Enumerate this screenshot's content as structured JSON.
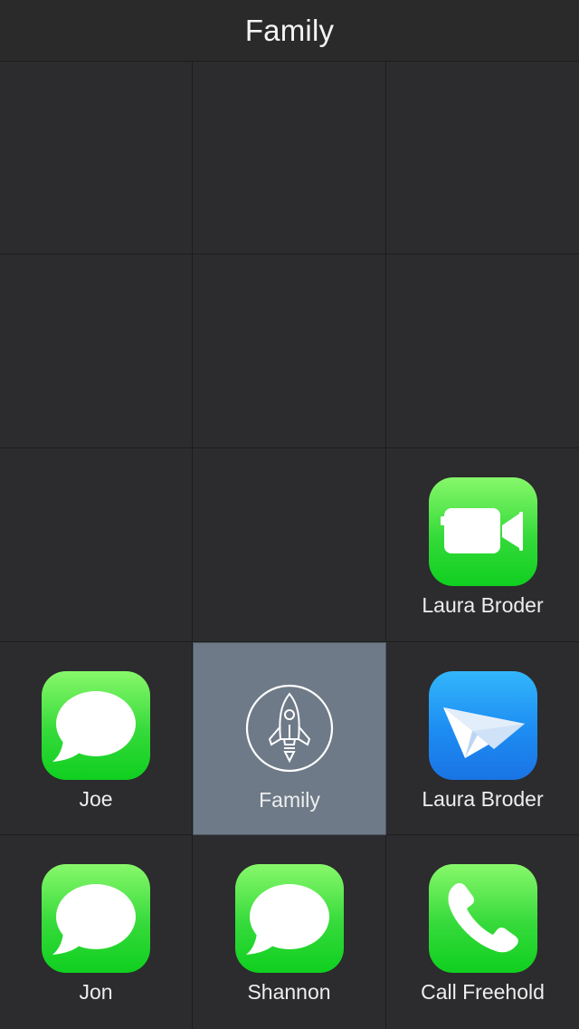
{
  "header": {
    "title": "Family"
  },
  "tiles": {
    "facetime": {
      "label": "Laura Broder",
      "icon": "facetime-icon"
    },
    "joe": {
      "label": "Joe",
      "icon": "messages-icon"
    },
    "family": {
      "label": "Family",
      "icon": "rocket-icon"
    },
    "mail": {
      "label": "Laura Broder",
      "icon": "paper-plane-icon"
    },
    "jon": {
      "label": "Jon",
      "icon": "messages-icon"
    },
    "shannon": {
      "label": "Shannon",
      "icon": "messages-icon"
    },
    "call": {
      "label": "Call Freehold",
      "icon": "phone-icon"
    }
  },
  "colors": {
    "background": "#2c2b2d",
    "selected": "#6e7a88",
    "green_top": "#87f86b",
    "green_bottom": "#0fcf1f",
    "blue_top": "#32b6fb",
    "blue_bottom": "#1a74e4"
  }
}
